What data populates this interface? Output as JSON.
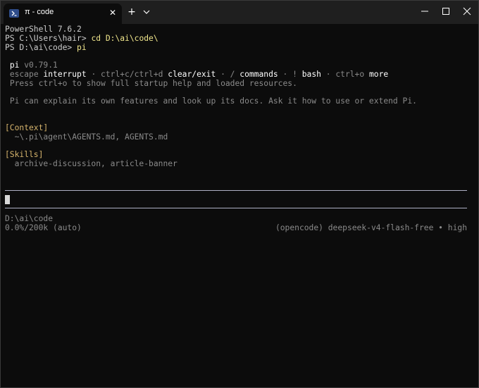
{
  "tab": {
    "title": "π - code",
    "close": "✕"
  },
  "new_tab": "+",
  "terminal": {
    "ps_version": "PowerShell 7.6.2",
    "prompt1": "PS C:\\Users\\hair> ",
    "cmd1": "cd D:\\ai\\code\\",
    "prompt2": "PS D:\\ai\\code> ",
    "cmd2": "pi",
    "pi_name": "pi",
    "pi_version": " v0.79.1",
    "hint_escape": "escape ",
    "hint_interrupt": "interrupt",
    "hint_sep1": " · ctrl+c/ctrl+d ",
    "hint_clear": "clear/exit",
    "hint_sep2": " · / ",
    "hint_commands": "commands",
    "hint_sep3": " · ! ",
    "hint_bash": "bash",
    "hint_sep4": " · ctrl+o ",
    "hint_more": "more",
    "startup_help": "Press ctrl+o to show full startup help and loaded resources.",
    "explain": "Pi can explain its own features and look up its docs. Ask it how to use or extend Pi.",
    "context_header": "[Context]",
    "context_files": "  ~\\.pi\\agent\\AGENTS.md, AGENTS.md",
    "skills_header": "[Skills]",
    "skills_list": "  archive-discussion, article-banner",
    "cwd": "D:\\ai\\code",
    "usage": "0.0%/200k (auto)",
    "model": "(opencode) deepseek-v4-flash-free • high"
  },
  "colors": {
    "background": "#0c0c0c",
    "text": "#cccccc",
    "dim": "#8a8a8a",
    "accent": "#f0e68c",
    "section": "#d7b56d"
  },
  "icons": [
    "powershell-icon",
    "close-icon",
    "plus-icon",
    "chevron-down-icon",
    "minimize-icon",
    "maximize-icon",
    "window-close-icon"
  ]
}
